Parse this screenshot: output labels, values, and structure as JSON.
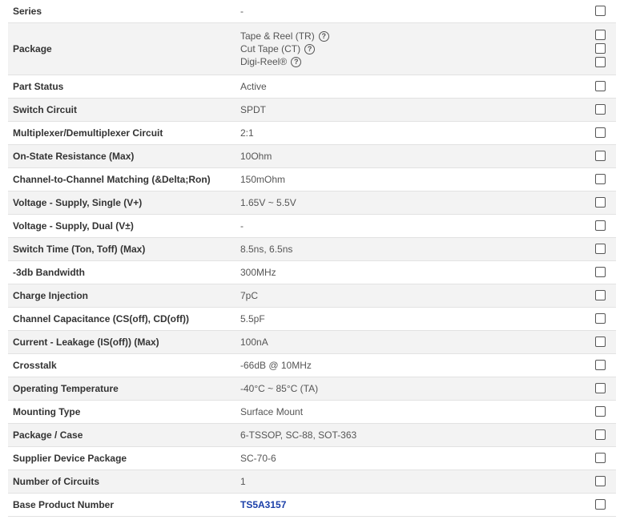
{
  "rows": [
    {
      "attr": "Series",
      "value": "-"
    },
    {
      "attr": "Package",
      "options": [
        "Tape & Reel (TR)",
        "Cut Tape (CT)",
        "Digi-Reel®"
      ]
    },
    {
      "attr": "Part Status",
      "value": "Active"
    },
    {
      "attr": "Switch Circuit",
      "value": "SPDT"
    },
    {
      "attr": "Multiplexer/Demultiplexer Circuit",
      "value": "2:1"
    },
    {
      "attr": "On-State Resistance (Max)",
      "value": "10Ohm"
    },
    {
      "attr": "Channel-to-Channel Matching (&Delta;Ron)",
      "value": "150mOhm"
    },
    {
      "attr": "Voltage - Supply, Single (V+)",
      "value": "1.65V ~ 5.5V"
    },
    {
      "attr": "Voltage - Supply, Dual (V±)",
      "value": "-"
    },
    {
      "attr": "Switch Time (Ton, Toff) (Max)",
      "value": "8.5ns, 6.5ns"
    },
    {
      "attr": "-3db Bandwidth",
      "value": "300MHz"
    },
    {
      "attr": "Charge Injection",
      "value": "7pC"
    },
    {
      "attr": "Channel Capacitance (CS(off), CD(off))",
      "value": "5.5pF"
    },
    {
      "attr": "Current - Leakage (IS(off)) (Max)",
      "value": "100nA"
    },
    {
      "attr": "Crosstalk",
      "value": "-66dB @ 10MHz"
    },
    {
      "attr": "Operating Temperature",
      "value": "-40°C ~ 85°C (TA)"
    },
    {
      "attr": "Mounting Type",
      "value": "Surface Mount"
    },
    {
      "attr": "Package / Case",
      "value": "6-TSSOP, SC-88, SOT-363"
    },
    {
      "attr": "Supplier Device Package",
      "value": "SC-70-6"
    },
    {
      "attr": "Number of Circuits",
      "value": "1"
    },
    {
      "attr": "Base Product Number",
      "value": "TS5A3157"
    }
  ],
  "help_glyph": "?",
  "colors": {
    "link": "#1a3ea8",
    "alt_row": "#f3f3f3",
    "border": "#e2e2e2"
  },
  "icons": {
    "help": "question-circle-icon",
    "checkbox": "checkbox"
  }
}
